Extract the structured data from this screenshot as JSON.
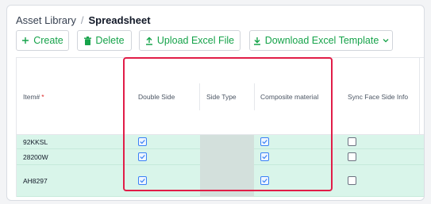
{
  "breadcrumb": {
    "parent": "Asset Library",
    "separator": "/",
    "current": "Spreadsheet"
  },
  "toolbar": {
    "create_label": "Create",
    "delete_label": "Delete",
    "upload_label": "Upload Excel File",
    "download_label": "Download Excel Template"
  },
  "table": {
    "columns": [
      "Item#",
      "Double Side",
      "Side Type",
      "Composite material",
      "Sync Face Side Info"
    ],
    "required_marker": "*",
    "rows": [
      {
        "item": "92KKSL",
        "double_side": true,
        "composite_material": true,
        "sync_face_side_info": false
      },
      {
        "item": "28200W",
        "double_side": true,
        "composite_material": true,
        "sync_face_side_info": false
      },
      {
        "item": "AH8297",
        "double_side": true,
        "composite_material": true,
        "sync_face_side_info": false
      }
    ]
  },
  "colors": {
    "accent": "#16a34a",
    "row_background": "#d9f5ea",
    "disabled_cell": "#d3e0dc",
    "highlight_border": "#e11d48",
    "checkbox_checked": "#3b82f6"
  }
}
